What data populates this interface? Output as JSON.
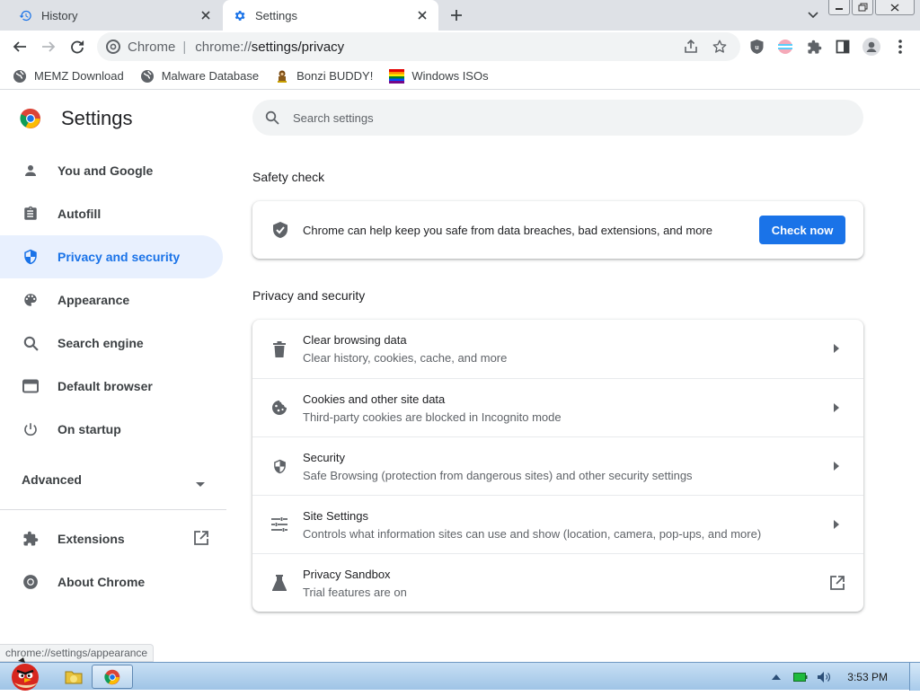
{
  "tabs": [
    {
      "label": "History",
      "active": false,
      "icon": "history-icon"
    },
    {
      "label": "Settings",
      "active": true,
      "icon": "gear-icon"
    }
  ],
  "address": {
    "site_chip": "Chrome",
    "url_scheme": "chrome://",
    "url_rest": "settings/privacy"
  },
  "bookmarks": [
    {
      "label": "MEMZ Download",
      "icon": "globe-icon"
    },
    {
      "label": "Malware Database",
      "icon": "globe-icon"
    },
    {
      "label": "Bonzi BUDDY!",
      "icon": "bonzi-icon"
    },
    {
      "label": "Windows ISOs",
      "icon": "windows-flag-icon"
    }
  ],
  "settings": {
    "title": "Settings",
    "search_placeholder": "Search settings",
    "nav": [
      {
        "label": "You and Google",
        "icon": "person-icon"
      },
      {
        "label": "Autofill",
        "icon": "clipboard-icon"
      },
      {
        "label": "Privacy and security",
        "icon": "shield-icon",
        "active": true
      },
      {
        "label": "Appearance",
        "icon": "palette-icon"
      },
      {
        "label": "Search engine",
        "icon": "search-icon"
      },
      {
        "label": "Default browser",
        "icon": "browser-icon"
      },
      {
        "label": "On startup",
        "icon": "power-icon"
      }
    ],
    "advanced_label": "Advanced",
    "extensions_label": "Extensions",
    "about_label": "About Chrome",
    "safety_check": {
      "heading": "Safety check",
      "text": "Chrome can help keep you safe from data breaches, bad extensions, and more",
      "button": "Check now"
    },
    "privacy_heading": "Privacy and security",
    "privacy_rows": [
      {
        "title": "Clear browsing data",
        "subtitle": "Clear history, cookies, cache, and more",
        "icon": "trash-icon"
      },
      {
        "title": "Cookies and other site data",
        "subtitle": "Third-party cookies are blocked in Incognito mode",
        "icon": "cookie-icon"
      },
      {
        "title": "Security",
        "subtitle": "Safe Browsing (protection from dangerous sites) and other security settings",
        "icon": "shield-icon"
      },
      {
        "title": "Site Settings",
        "subtitle": "Controls what information sites can use and show (location, camera, pop-ups, and more)",
        "icon": "sliders-icon"
      },
      {
        "title": "Privacy Sandbox",
        "subtitle": "Trial features are on",
        "icon": "flask-icon"
      }
    ]
  },
  "status_bubble": "chrome://settings/appearance",
  "taskbar": {
    "clock": "3:53 PM"
  },
  "colors": {
    "accent": "#1a73e8",
    "active_nav_bg": "#e8f0fe",
    "tabstrip": "#dee1e6"
  }
}
